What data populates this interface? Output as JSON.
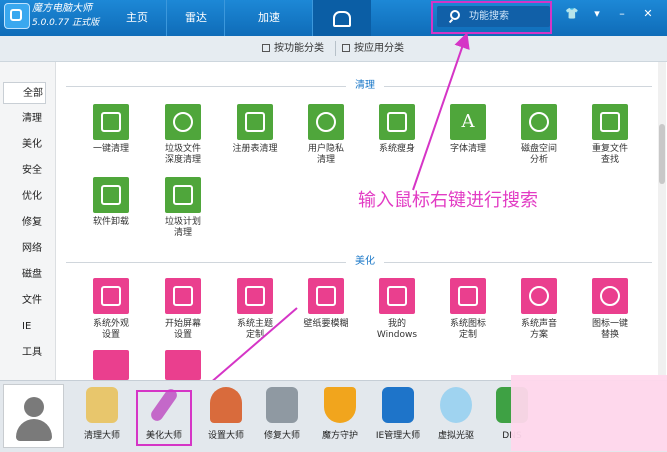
{
  "app": {
    "name": "魔方电脑大师",
    "version": "5.0.0.77 正式版"
  },
  "nav": [
    "主页",
    "雷达",
    "加速"
  ],
  "search": {
    "placeholder": "功能搜索"
  },
  "window_buttons": [
    "👕",
    "▾",
    "–",
    "✕"
  ],
  "subtabs": [
    "按功能分类",
    "按应用分类"
  ],
  "sidebar": [
    "全部",
    "清理",
    "美化",
    "安全",
    "优化",
    "修复",
    "网络",
    "磁盘",
    "文件",
    "IE",
    "工具"
  ],
  "sections": {
    "clean": {
      "title": "清理",
      "tiles": [
        "一键清理",
        "垃圾文件\n深度清理",
        "注册表清理",
        "用户隐私\n清理",
        "系统瘦身",
        "字体清理",
        "磁盘空间\n分析",
        "重复文件\n查找",
        "软件卸载",
        "垃圾计划\n清理"
      ]
    },
    "beautify": {
      "title": "美化",
      "tiles": [
        "系统外观\n设置",
        "开始屏幕\n设置",
        "系统主题\n定制",
        "壁纸要模糊",
        "我的\nWindows",
        "系统图标\n定制",
        "系统声音\n方案",
        "图标一键\n替换"
      ]
    }
  },
  "annotation": "输入鼠标右键进行搜索",
  "dock": [
    "清理大师",
    "美化大师",
    "设置大师",
    "修复大师",
    "魔方守护",
    "IE管理大师",
    "虚拟光驱",
    "DNS"
  ],
  "colors": {
    "topbar": "#1d88d6",
    "green_tile": "#4fa63b",
    "pink_tile": "#ea3f8e",
    "highlight": "#d535c6",
    "section_title": "#1b78c8"
  },
  "icons": {
    "clean": [
      "broom-icon",
      "recycle-icon",
      "registry-grid-icon",
      "privacy-lock-icon",
      "slim-icon",
      "font-a-icon",
      "pie-chart-icon",
      "duplicate-search-icon",
      "uninstall-icon",
      "schedule-broom-icon"
    ],
    "beautify": [
      "appearance-icon",
      "start-screen-icon",
      "theme-icon",
      "wallpaper-icon",
      "windows-icon",
      "system-icon-icon",
      "sound-icon",
      "icon-replace-icon"
    ]
  }
}
